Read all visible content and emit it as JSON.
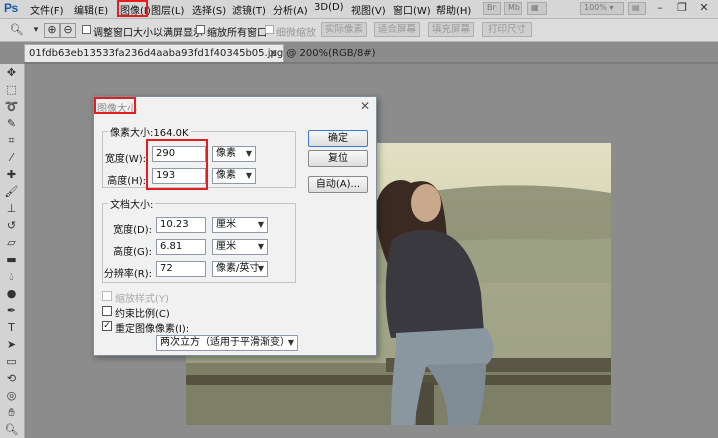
{
  "app": {
    "logo": "Ps"
  },
  "menu": [
    {
      "label": "文件(F)"
    },
    {
      "label": "编辑(E)"
    },
    {
      "label": "图像(I)"
    },
    {
      "label": "图层(L)"
    },
    {
      "label": "选择(S)"
    },
    {
      "label": "滤镜(T)"
    },
    {
      "label": "分析(A)"
    },
    {
      "label": "3D(D)"
    },
    {
      "label": "视图(V)"
    },
    {
      "label": "窗口(W)"
    },
    {
      "label": "帮助(H)"
    }
  ],
  "zoom_display": "100%",
  "window_controls": {
    "minimize": "–",
    "restore": "❐",
    "close": "✕"
  },
  "options_bar": {
    "resize_windows_label": "调整窗口大小以满屏显示",
    "zoom_all_label": "缩放所有窗口",
    "scrubby_label": "细微缩放",
    "actual_pixels": "实际像素",
    "fit_screen": "适合屏幕",
    "fill_screen": "填充屏幕",
    "print_size": "打印尺寸"
  },
  "document": {
    "tab_title": "01fdb63eb13533fa236d4aaba93fd1f40345b05.jpg @ 200%(RGB/8#)",
    "close": "✕"
  },
  "dialog": {
    "title": "图像大小",
    "close": "✕",
    "pixel_dimensions": {
      "legend": "像素大小:164.0K",
      "width_label": "宽度(W):",
      "width_value": "290",
      "width_unit": "像素",
      "height_label": "高度(H):",
      "height_value": "193",
      "height_unit": "像素"
    },
    "document_size": {
      "legend": "文档大小:",
      "width_label": "宽度(D):",
      "width_value": "10.23",
      "width_unit": "厘米",
      "height_label": "高度(G):",
      "height_value": "6.81",
      "height_unit": "厘米",
      "resolution_label": "分辨率(R):",
      "resolution_value": "72",
      "resolution_unit": "像素/英寸"
    },
    "scale_styles": "缩放样式(Y)",
    "constrain": "约束比例(C)",
    "resample": "重定图像像素(I):",
    "resample_method": "两次立方（适用于平滑渐变）",
    "buttons": {
      "ok": "确定",
      "reset": "复位",
      "auto": "自动(A)..."
    }
  },
  "colors": {
    "highlight": "#e02020",
    "accent": "#3d7bd0"
  }
}
